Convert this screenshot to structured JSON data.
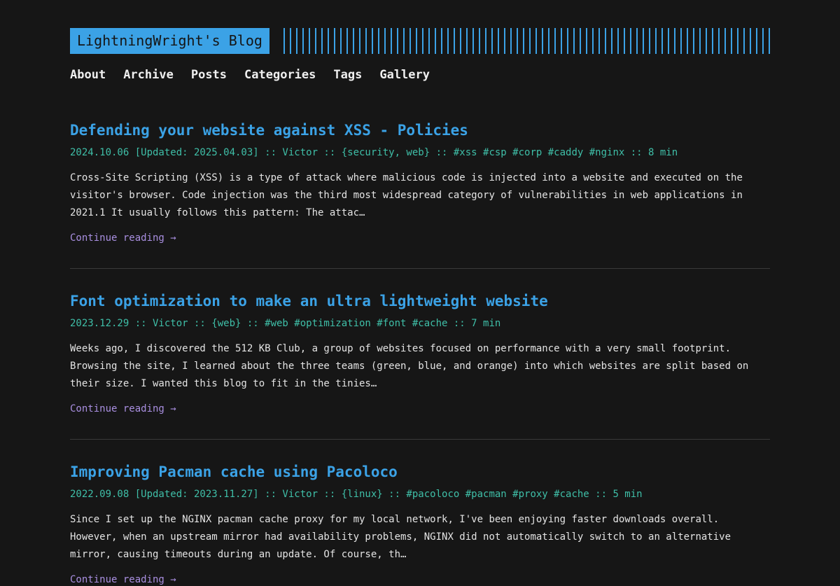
{
  "colors": {
    "background": "#161616",
    "accent": "#3ba2e6",
    "meta": "#3fbfa8",
    "link": "#a98fe0",
    "text": "#e4e4e4"
  },
  "header": {
    "logo": "LightningWright's Blog"
  },
  "nav": {
    "items": [
      "About",
      "Archive",
      "Posts",
      "Categories",
      "Tags",
      "Gallery"
    ]
  },
  "posts": [
    {
      "title": "Defending your website against XSS - Policies",
      "meta": "2024.10.06 [Updated: 2025.04.03] :: Victor :: {security, web} :: #xss #csp #corp #caddy #nginx :: 8 min",
      "excerpt": "Cross-Site Scripting (XSS) is a type of attack where malicious code is injected into a website and executed on the visitor's browser. Code injection was the third most widespread category of vulnerabilities in web applications in 2021.1 It usually follows this pattern: The attac…",
      "continue": "Continue reading →"
    },
    {
      "title": "Font optimization to make an ultra lightweight website",
      "meta": "2023.12.29 :: Victor :: {web} :: #web #optimization #font #cache :: 7 min",
      "excerpt": "Weeks ago, I discovered the 512 KB Club, a group of websites focused on performance with a very small footprint. Browsing the site, I learned about the three teams (green, blue, and orange) into which websites are split based on their size. I wanted this blog to fit in the tinies…",
      "continue": "Continue reading →"
    },
    {
      "title": "Improving Pacman cache using Pacoloco",
      "meta": "2022.09.08 [Updated: 2023.11.27] :: Victor :: {linux} :: #pacoloco #pacman #proxy #cache :: 5 min",
      "excerpt": "Since I set up the NGINX pacman cache proxy for my local network, I've been enjoying faster downloads overall. However, when an upstream mirror had availability problems, NGINX did not automatically switch to an alternative mirror, causing timeouts during an update. Of course, th…",
      "continue": "Continue reading →"
    }
  ]
}
